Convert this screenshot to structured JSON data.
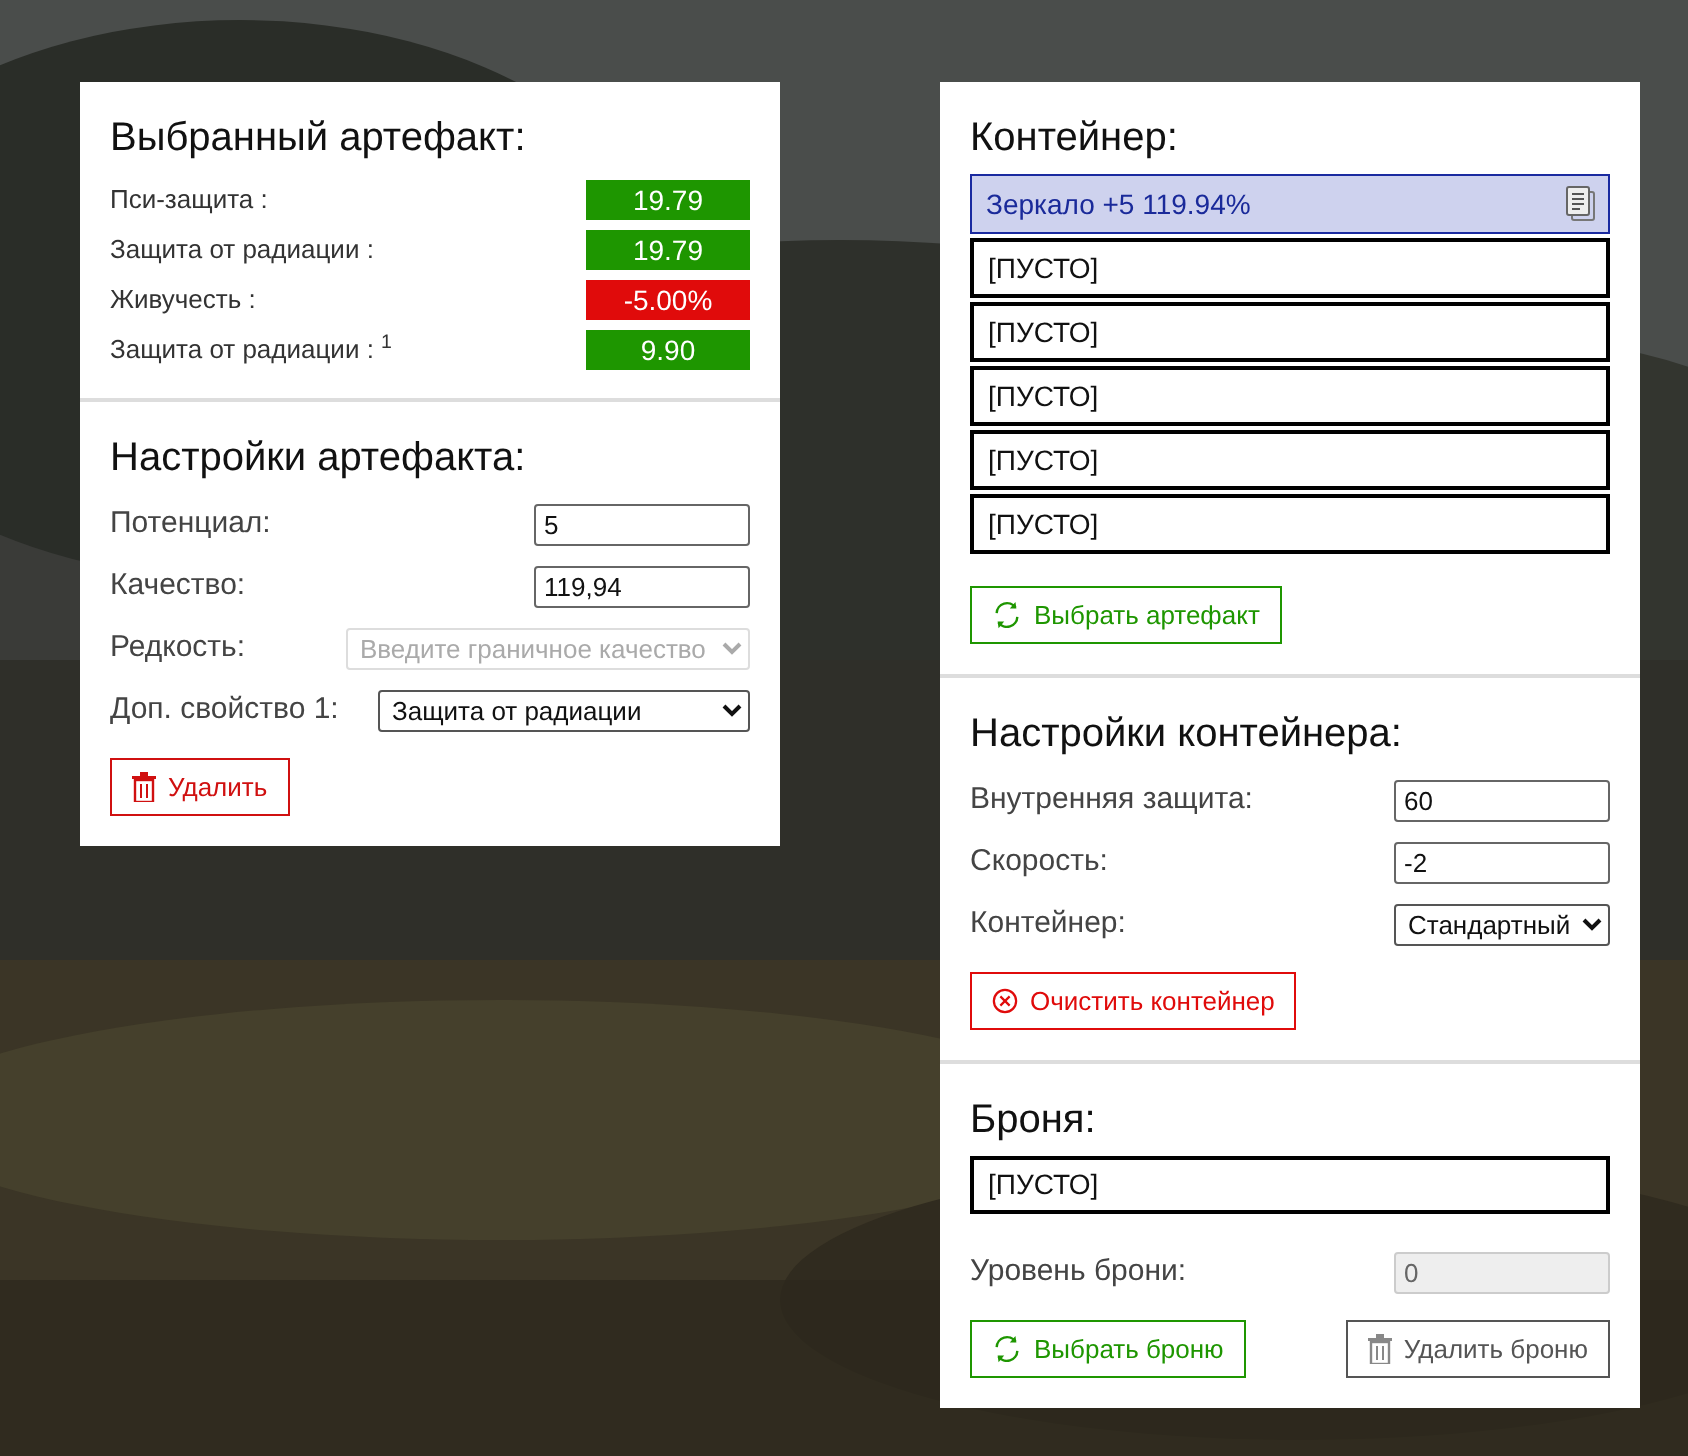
{
  "artifact": {
    "title": "Выбранный артефакт:",
    "stats": [
      {
        "label": "Пси-защита :",
        "value": "19.79",
        "color": "#1e9600"
      },
      {
        "label": "Защита от радиации :",
        "value": "19.79",
        "color": "#1e9600"
      },
      {
        "label": "Живучесть :",
        "value": "-5.00%",
        "color": "#e00b0b"
      },
      {
        "label": "Защита от радиации : $^{1}$",
        "value": "9.90",
        "color": "#1e9600"
      }
    ]
  },
  "artifact_settings": {
    "title": "Настройки артефакта:",
    "fields": [
      {
        "kind": "input",
        "label": "Потенциал:",
        "value": "5",
        "disabled": false
      },
      {
        "kind": "input",
        "label": "Качество:",
        "value": "119,94",
        "disabled": false
      },
      {
        "kind": "select",
        "label": "Редкость:",
        "value": "Введите граничное качество",
        "disabled": true
      },
      {
        "kind": "select",
        "label": "Доп. свойство 1:",
        "value": "Защита от радиации",
        "disabled": false
      }
    ],
    "delete_button": "Удалить"
  },
  "container": {
    "title": "Контейнер:",
    "slots": [
      {
        "kind": "artifact",
        "text": "Зеркало +5 119.94%",
        "selected": true
      },
      {
        "kind": "empty",
        "text": "[ПУСТО]",
        "selected": false
      },
      {
        "kind": "empty",
        "text": "[ПУСТО]",
        "selected": false
      },
      {
        "kind": "empty",
        "text": "[ПУСТО]",
        "selected": false
      },
      {
        "kind": "empty",
        "text": "[ПУСТО]",
        "selected": false
      },
      {
        "kind": "empty",
        "text": "[ПУСТО]",
        "selected": false
      }
    ],
    "choose_button": "Выбрать артефакт"
  },
  "container_settings": {
    "title": "Настройки контейнера:",
    "fields": [
      {
        "kind": "input",
        "label": "Внутренняя защита:",
        "value": "60",
        "disabled": false
      },
      {
        "kind": "input",
        "label": "Скорость:",
        "value": "-2",
        "disabled": false
      },
      {
        "kind": "select",
        "label": "Контейнер:",
        "value": "Стандартный",
        "disabled": false
      }
    ],
    "clear_button": "Очистить контейнер"
  },
  "armor": {
    "title": "Броня:",
    "slot": {
      "text": "[ПУСТО]",
      "selected": false
    },
    "level_field": {
      "kind": "input",
      "label": "Уровень брони:",
      "value": "0",
      "disabled": true
    },
    "choose_button": "Выбрать броню",
    "delete_button": "Удалить броню"
  }
}
